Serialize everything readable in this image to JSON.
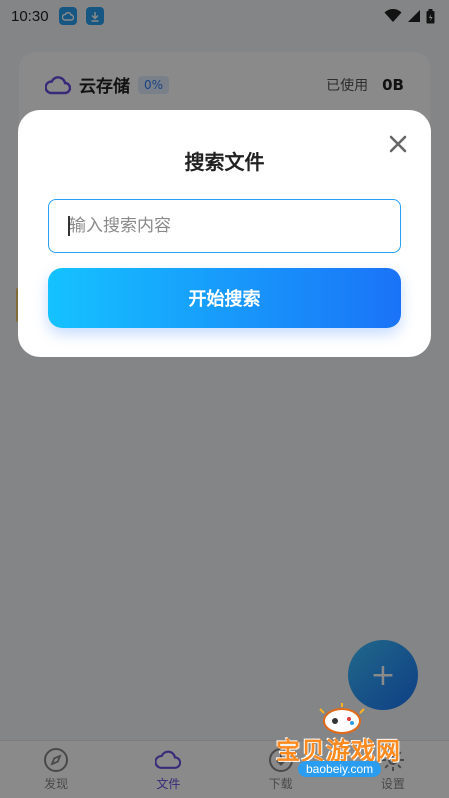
{
  "status_bar": {
    "time": "10:30"
  },
  "storage_card": {
    "title": "云存储",
    "badge": "0%",
    "used_label": "已使用",
    "used_value": "0B"
  },
  "dialog": {
    "title": "搜索文件",
    "input_placeholder": "输入搜索内容",
    "input_value": "",
    "start_button_label": "开始搜索"
  },
  "fab": {
    "label": "+"
  },
  "bottom_nav": [
    {
      "label": "发现",
      "icon": "compass-icon"
    },
    {
      "label": "文件",
      "icon": "cloud-icon"
    },
    {
      "label": "下载",
      "icon": "download-icon"
    },
    {
      "label": "设置",
      "icon": "gear-icon"
    }
  ],
  "watermark": {
    "text": "宝贝游戏网",
    "url": "baobeiy.com"
  },
  "colors": {
    "accent_start": "#15c2ff",
    "accent_end": "#1a73f7",
    "nav_active": "#6a4de0",
    "input_border": "#2aa0f3"
  }
}
